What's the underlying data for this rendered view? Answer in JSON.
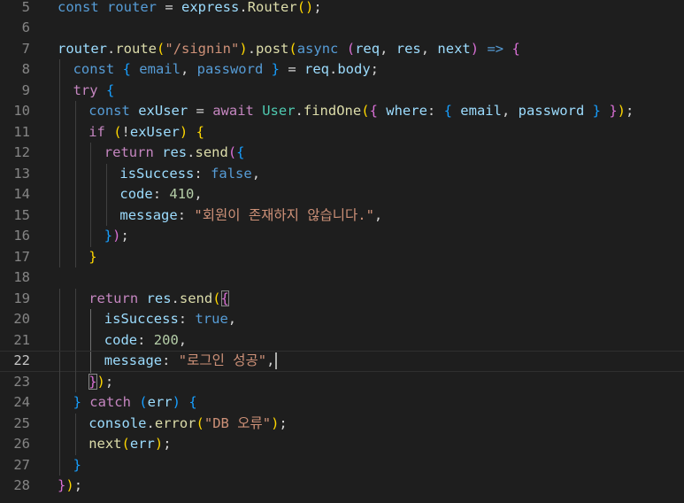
{
  "colors": {
    "background": "#1e1e1e",
    "line_number": "#858585",
    "line_number_active": "#c6c6c6",
    "keyword": "#569cd6",
    "control": "#c586c0",
    "variable": "#9cdcfe",
    "function": "#dcdcaa",
    "type": "#4ec9b0",
    "string": "#ce9178",
    "number": "#b5cea8",
    "text": "#d4d4d4",
    "bracket1": "#ffd700",
    "bracket2": "#da70d6",
    "bracket3": "#179fff"
  },
  "editor": {
    "current_line": 22,
    "lines": [
      {
        "num": "5",
        "indent": 0,
        "tokens": [
          {
            "t": "const",
            "c": "keyword"
          },
          {
            "t": " ",
            "c": "text"
          },
          {
            "t": "router",
            "c": "keyword"
          },
          {
            "t": " = ",
            "c": "text"
          },
          {
            "t": "express",
            "c": "variable"
          },
          {
            "t": ".",
            "c": "text"
          },
          {
            "t": "Router",
            "c": "function"
          },
          {
            "t": "()",
            "c": "bracket1"
          },
          {
            "t": ";",
            "c": "text"
          }
        ]
      },
      {
        "num": "6",
        "indent": 0,
        "tokens": []
      },
      {
        "num": "7",
        "indent": 0,
        "tokens": [
          {
            "t": "router",
            "c": "variable"
          },
          {
            "t": ".",
            "c": "text"
          },
          {
            "t": "route",
            "c": "function"
          },
          {
            "t": "(",
            "c": "bracket1"
          },
          {
            "t": "\"/signin\"",
            "c": "string"
          },
          {
            "t": ")",
            "c": "bracket1"
          },
          {
            "t": ".",
            "c": "text"
          },
          {
            "t": "post",
            "c": "function"
          },
          {
            "t": "(",
            "c": "bracket1"
          },
          {
            "t": "async",
            "c": "keyword"
          },
          {
            "t": " ",
            "c": "text"
          },
          {
            "t": "(",
            "c": "bracket2"
          },
          {
            "t": "req",
            "c": "variable"
          },
          {
            "t": ", ",
            "c": "text"
          },
          {
            "t": "res",
            "c": "variable"
          },
          {
            "t": ", ",
            "c": "text"
          },
          {
            "t": "next",
            "c": "variable"
          },
          {
            "t": ")",
            "c": "bracket2"
          },
          {
            "t": " ",
            "c": "text"
          },
          {
            "t": "=>",
            "c": "keyword"
          },
          {
            "t": " ",
            "c": "text"
          },
          {
            "t": "{",
            "c": "bracket2"
          }
        ]
      },
      {
        "num": "8",
        "indent": 1,
        "tokens": [
          {
            "t": "const",
            "c": "keyword"
          },
          {
            "t": " ",
            "c": "text"
          },
          {
            "t": "{",
            "c": "bracket3"
          },
          {
            "t": " ",
            "c": "text"
          },
          {
            "t": "email",
            "c": "keyword"
          },
          {
            "t": ", ",
            "c": "text"
          },
          {
            "t": "password",
            "c": "keyword"
          },
          {
            "t": " ",
            "c": "text"
          },
          {
            "t": "}",
            "c": "bracket3"
          },
          {
            "t": " = ",
            "c": "text"
          },
          {
            "t": "req",
            "c": "variable"
          },
          {
            "t": ".",
            "c": "text"
          },
          {
            "t": "body",
            "c": "variable"
          },
          {
            "t": ";",
            "c": "text"
          }
        ]
      },
      {
        "num": "9",
        "indent": 1,
        "tokens": [
          {
            "t": "try",
            "c": "control"
          },
          {
            "t": " ",
            "c": "text"
          },
          {
            "t": "{",
            "c": "bracket3"
          }
        ]
      },
      {
        "num": "10",
        "indent": 2,
        "tokens": [
          {
            "t": "const",
            "c": "keyword"
          },
          {
            "t": " ",
            "c": "text"
          },
          {
            "t": "exUser",
            "c": "variable"
          },
          {
            "t": " = ",
            "c": "text"
          },
          {
            "t": "await",
            "c": "control"
          },
          {
            "t": " ",
            "c": "text"
          },
          {
            "t": "User",
            "c": "type"
          },
          {
            "t": ".",
            "c": "text"
          },
          {
            "t": "findOne",
            "c": "function"
          },
          {
            "t": "(",
            "c": "bracket1"
          },
          {
            "t": "{",
            "c": "bracket2"
          },
          {
            "t": " ",
            "c": "text"
          },
          {
            "t": "where",
            "c": "variable"
          },
          {
            "t": ": ",
            "c": "text"
          },
          {
            "t": "{",
            "c": "bracket3"
          },
          {
            "t": " ",
            "c": "text"
          },
          {
            "t": "email",
            "c": "variable"
          },
          {
            "t": ", ",
            "c": "text"
          },
          {
            "t": "password",
            "c": "variable"
          },
          {
            "t": " ",
            "c": "text"
          },
          {
            "t": "}",
            "c": "bracket3"
          },
          {
            "t": " ",
            "c": "text"
          },
          {
            "t": "}",
            "c": "bracket2"
          },
          {
            "t": ")",
            "c": "bracket1"
          },
          {
            "t": ";",
            "c": "text"
          }
        ]
      },
      {
        "num": "11",
        "indent": 2,
        "tokens": [
          {
            "t": "if",
            "c": "control"
          },
          {
            "t": " ",
            "c": "text"
          },
          {
            "t": "(",
            "c": "bracket1"
          },
          {
            "t": "!",
            "c": "text"
          },
          {
            "t": "exUser",
            "c": "variable"
          },
          {
            "t": ")",
            "c": "bracket1"
          },
          {
            "t": " ",
            "c": "text"
          },
          {
            "t": "{",
            "c": "bracket1"
          }
        ]
      },
      {
        "num": "12",
        "indent": 3,
        "tokens": [
          {
            "t": "return",
            "c": "control"
          },
          {
            "t": " ",
            "c": "text"
          },
          {
            "t": "res",
            "c": "variable"
          },
          {
            "t": ".",
            "c": "text"
          },
          {
            "t": "send",
            "c": "function"
          },
          {
            "t": "(",
            "c": "bracket2"
          },
          {
            "t": "{",
            "c": "bracket3"
          }
        ]
      },
      {
        "num": "13",
        "indent": 4,
        "tokens": [
          {
            "t": "isSuccess",
            "c": "variable"
          },
          {
            "t": ": ",
            "c": "text"
          },
          {
            "t": "false",
            "c": "keyword"
          },
          {
            "t": ",",
            "c": "text"
          }
        ]
      },
      {
        "num": "14",
        "indent": 4,
        "tokens": [
          {
            "t": "code",
            "c": "variable"
          },
          {
            "t": ": ",
            "c": "text"
          },
          {
            "t": "410",
            "c": "number"
          },
          {
            "t": ",",
            "c": "text"
          }
        ]
      },
      {
        "num": "15",
        "indent": 4,
        "tokens": [
          {
            "t": "message",
            "c": "variable"
          },
          {
            "t": ": ",
            "c": "text"
          },
          {
            "t": "\"회원이 존재하지 않습니다.\"",
            "c": "string"
          },
          {
            "t": ",",
            "c": "text"
          }
        ]
      },
      {
        "num": "16",
        "indent": 3,
        "tokens": [
          {
            "t": "}",
            "c": "bracket3"
          },
          {
            "t": ")",
            "c": "bracket2"
          },
          {
            "t": ";",
            "c": "text"
          }
        ]
      },
      {
        "num": "17",
        "indent": 2,
        "tokens": [
          {
            "t": "}",
            "c": "bracket1"
          }
        ]
      },
      {
        "num": "18",
        "indent": 0,
        "tokens": []
      },
      {
        "num": "19",
        "indent": 2,
        "tokens": [
          {
            "t": "return",
            "c": "control"
          },
          {
            "t": " ",
            "c": "text"
          },
          {
            "t": "res",
            "c": "variable"
          },
          {
            "t": ".",
            "c": "text"
          },
          {
            "t": "send",
            "c": "function"
          },
          {
            "t": "(",
            "c": "bracket1"
          },
          {
            "t": "{",
            "c": "bracket2",
            "match": true
          }
        ]
      },
      {
        "num": "20",
        "indent": 3,
        "tokens": [
          {
            "t": "isSuccess",
            "c": "variable"
          },
          {
            "t": ": ",
            "c": "text"
          },
          {
            "t": "true",
            "c": "keyword"
          },
          {
            "t": ",",
            "c": "text"
          }
        ]
      },
      {
        "num": "21",
        "indent": 3,
        "tokens": [
          {
            "t": "code",
            "c": "variable"
          },
          {
            "t": ": ",
            "c": "text"
          },
          {
            "t": "200",
            "c": "number"
          },
          {
            "t": ",",
            "c": "text"
          }
        ]
      },
      {
        "num": "22",
        "indent": 3,
        "cursor": true,
        "tokens": [
          {
            "t": "message",
            "c": "variable"
          },
          {
            "t": ": ",
            "c": "text"
          },
          {
            "t": "\"로그인 성공\"",
            "c": "string"
          },
          {
            "t": ",",
            "c": "text"
          }
        ]
      },
      {
        "num": "23",
        "indent": 2,
        "tokens": [
          {
            "t": "}",
            "c": "bracket2",
            "match": true
          },
          {
            "t": ")",
            "c": "bracket1"
          },
          {
            "t": ";",
            "c": "text"
          }
        ]
      },
      {
        "num": "24",
        "indent": 1,
        "tokens": [
          {
            "t": "}",
            "c": "bracket3"
          },
          {
            "t": " ",
            "c": "text"
          },
          {
            "t": "catch",
            "c": "control"
          },
          {
            "t": " ",
            "c": "text"
          },
          {
            "t": "(",
            "c": "bracket3"
          },
          {
            "t": "err",
            "c": "variable"
          },
          {
            "t": ")",
            "c": "bracket3"
          },
          {
            "t": " ",
            "c": "text"
          },
          {
            "t": "{",
            "c": "bracket3"
          }
        ]
      },
      {
        "num": "25",
        "indent": 2,
        "tokens": [
          {
            "t": "console",
            "c": "variable"
          },
          {
            "t": ".",
            "c": "text"
          },
          {
            "t": "error",
            "c": "function"
          },
          {
            "t": "(",
            "c": "bracket1"
          },
          {
            "t": "\"DB 오류\"",
            "c": "string"
          },
          {
            "t": ")",
            "c": "bracket1"
          },
          {
            "t": ";",
            "c": "text"
          }
        ]
      },
      {
        "num": "26",
        "indent": 2,
        "tokens": [
          {
            "t": "next",
            "c": "function"
          },
          {
            "t": "(",
            "c": "bracket1"
          },
          {
            "t": "err",
            "c": "variable"
          },
          {
            "t": ")",
            "c": "bracket1"
          },
          {
            "t": ";",
            "c": "text"
          }
        ]
      },
      {
        "num": "27",
        "indent": 1,
        "tokens": [
          {
            "t": "}",
            "c": "bracket3"
          }
        ]
      },
      {
        "num": "28",
        "indent": 0,
        "tokens": [
          {
            "t": "}",
            "c": "bracket2"
          },
          {
            "t": ")",
            "c": "bracket1"
          },
          {
            "t": ";",
            "c": "text"
          }
        ]
      }
    ]
  }
}
